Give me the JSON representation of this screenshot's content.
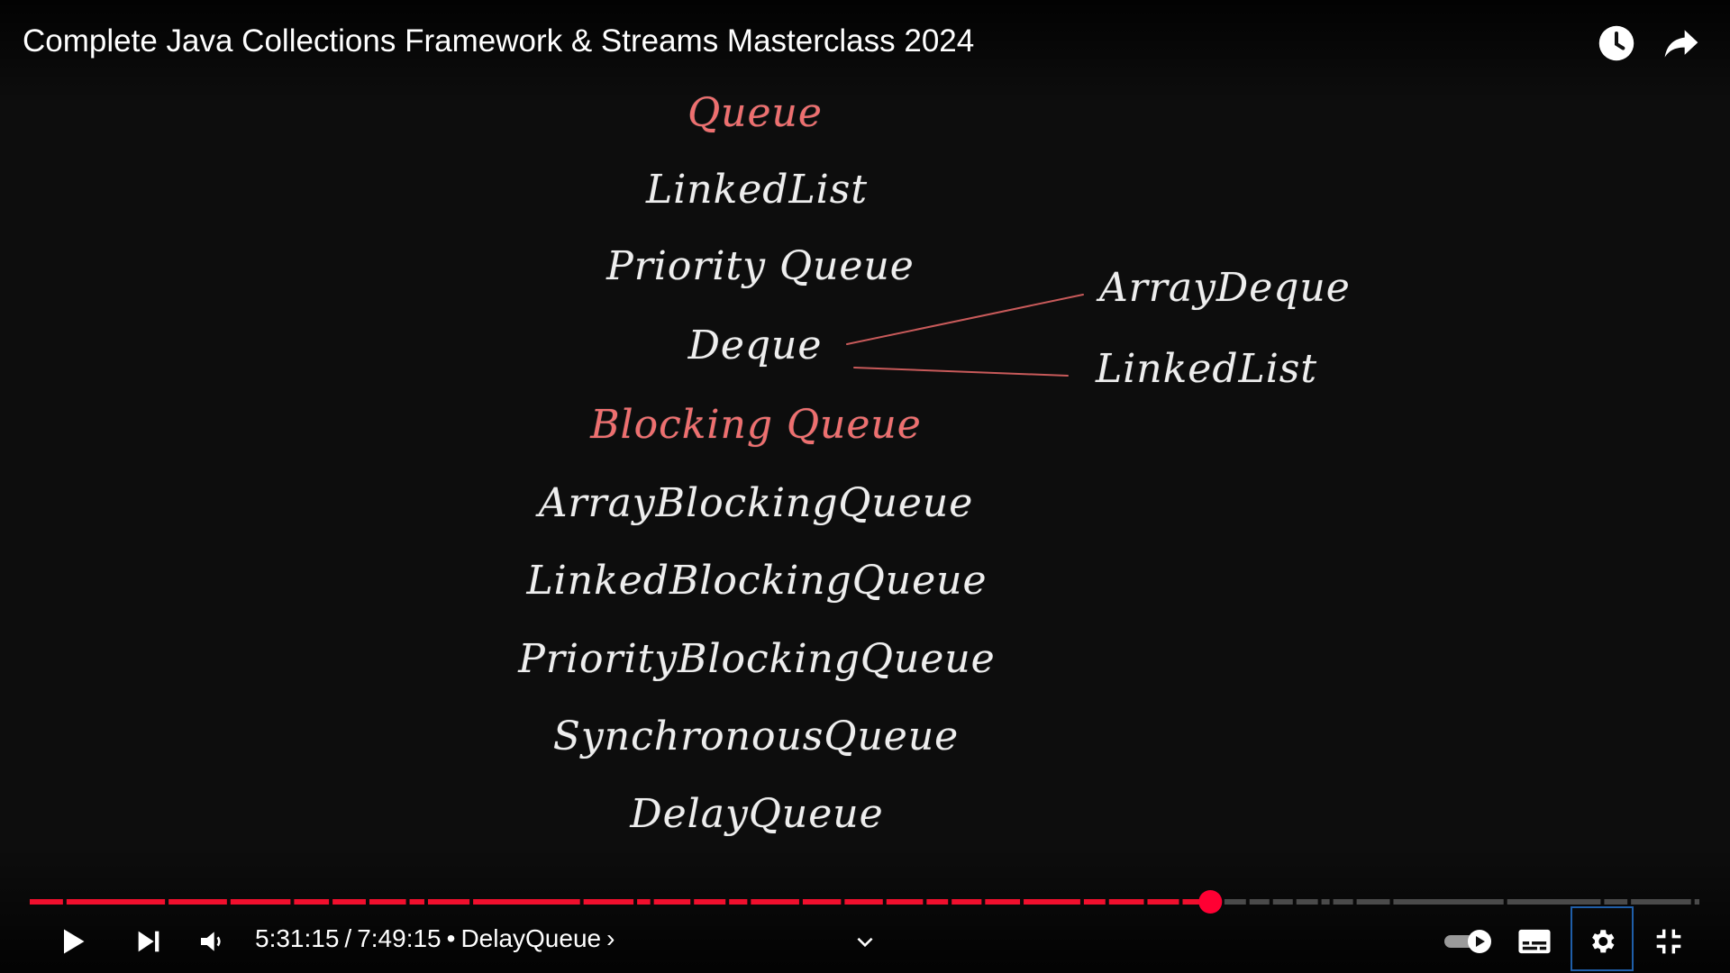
{
  "video": {
    "title": "Complete Java Collections Framework & Streams Masterclass 2024"
  },
  "icons": {
    "watch_later": "clock-icon",
    "share": "share-arrow-icon",
    "play": "play-icon",
    "next": "next-icon",
    "volume": "volume-icon",
    "chevron": "chevron-down-icon",
    "autoplay": "autoplay-toggle-icon",
    "subtitles": "subtitles-icon",
    "settings": "gear-icon",
    "exit_fullscreen": "exit-fullscreen-icon"
  },
  "slide": {
    "items": [
      {
        "text": "Queue",
        "color": "#ee6f6f"
      },
      {
        "text": "LinkedList",
        "color": "#eeeeee"
      },
      {
        "text": "Priority Queue",
        "color": "#eeeeee"
      },
      {
        "text": "Deque",
        "color": "#eeeeee"
      },
      {
        "text": "Blocking Queue",
        "color": "#ee6f6f"
      },
      {
        "text": "ArrayBlockingQueue",
        "color": "#eeeeee"
      },
      {
        "text": "LinkedBlockingQueue",
        "color": "#eeeeee"
      },
      {
        "text": "PriorityBlockingQueue",
        "color": "#eeeeee"
      },
      {
        "text": "SynchronousQueue",
        "color": "#eeeeee"
      },
      {
        "text": "DelayQueue",
        "color": "#eeeeee"
      }
    ],
    "branches": [
      "ArrayDeque",
      "LinkedList"
    ]
  },
  "player": {
    "current_time": "5:31:15",
    "separator": "/",
    "duration": "7:49:15",
    "bullet": "•",
    "chapter": "DelayQueue",
    "chapter_arrow": "›",
    "progress_fraction": 0.7056,
    "colors": {
      "played": "#f00f2d",
      "unplayed": "#4a4a4a",
      "scrubber": "#ff0033",
      "focus": "#1f5ea8"
    }
  }
}
